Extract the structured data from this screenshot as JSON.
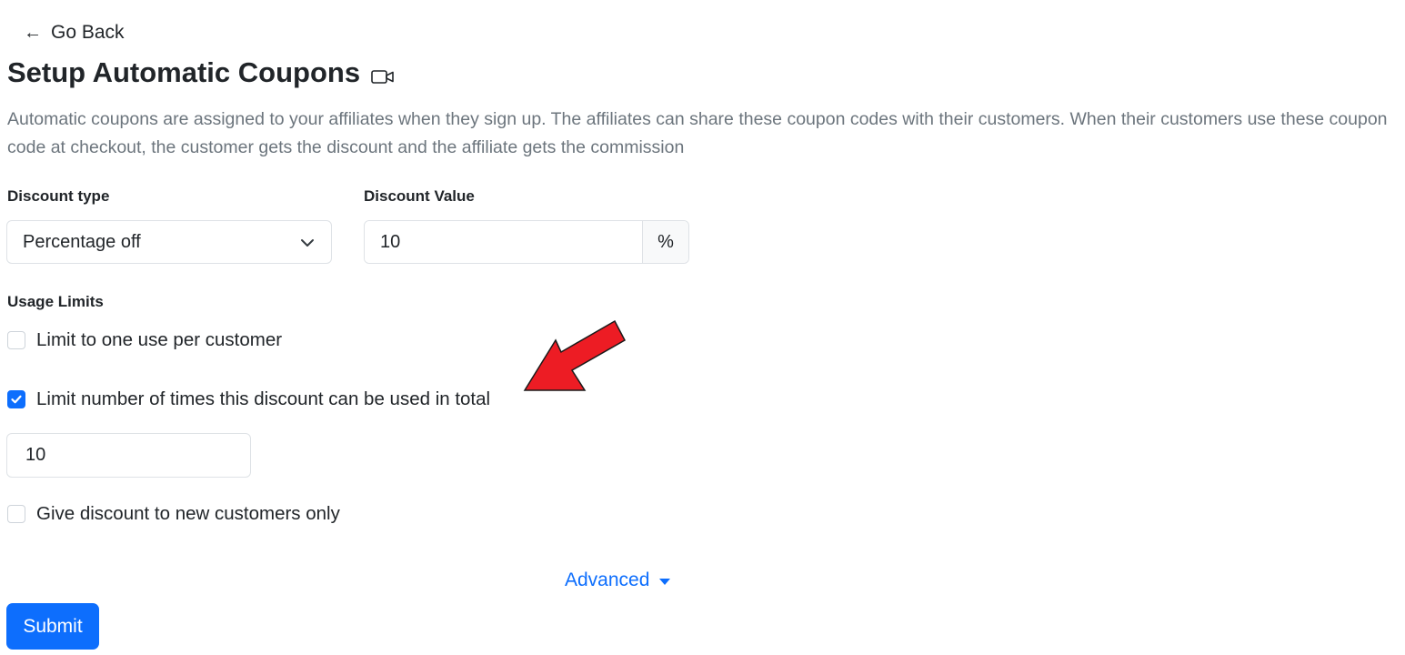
{
  "nav": {
    "go_back_label": "Go Back",
    "go_back_icon": "arrow-left-icon"
  },
  "header": {
    "title": "Setup Automatic Coupons",
    "title_icon": "video-camera-icon",
    "description": "Automatic coupons are assigned to your affiliates when they sign up. The affiliates can share these coupon codes with their customers. When their customers use these coupon code at checkout, the customer gets the discount and the affiliate gets the commission"
  },
  "form": {
    "discount_type": {
      "label": "Discount type",
      "selected": "Percentage off"
    },
    "discount_value": {
      "label": "Discount Value",
      "value": "10",
      "suffix": "%"
    },
    "usage_limits": {
      "label": "Usage Limits",
      "options": [
        {
          "label": "Limit to one use per customer",
          "checked": false
        },
        {
          "label": "Limit number of times this discount can be used in total",
          "checked": true
        },
        {
          "label": "Give discount to new customers only",
          "checked": false
        }
      ],
      "total_limit_value": "10"
    },
    "advanced_label": "Advanced",
    "submit_label": "Submit"
  },
  "colors": {
    "primary": "#0d6efd",
    "annotation_arrow": "#ed1c24",
    "muted_text": "#6c757d"
  }
}
